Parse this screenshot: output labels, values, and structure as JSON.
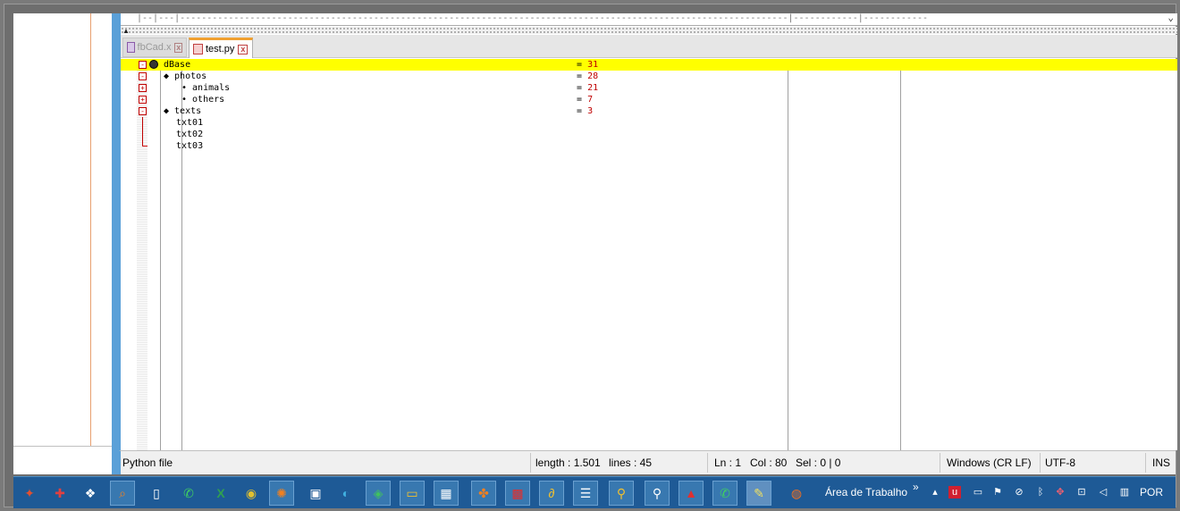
{
  "editor": {
    "ruler_text": "|--|---|-----------------------------------------------------------------------------------------------------------------|------------|------------",
    "tabs": [
      {
        "label": "fbCad.x",
        "close": "x"
      },
      {
        "label": "test.py",
        "close": "x"
      }
    ],
    "lines": [
      {
        "fold": "-",
        "text": "dBase",
        "value": "31",
        "indent": 0
      },
      {
        "fold": "-",
        "text": "◆ photos",
        "value": "28",
        "indent": 1
      },
      {
        "fold": "+",
        "text": "• animals",
        "value": "21",
        "indent": 2
      },
      {
        "fold": "+",
        "text": "• others",
        "value": "7",
        "indent": 2
      },
      {
        "fold": "-",
        "text": "◆ texts",
        "value": "3",
        "indent": 1
      },
      {
        "fold": "",
        "text": "txt01",
        "value": "",
        "indent": 1
      },
      {
        "fold": "",
        "text": "txt02",
        "value": "",
        "indent": 1
      },
      {
        "fold": "",
        "text": "txt03",
        "value": "",
        "indent": 1
      }
    ],
    "eq": "="
  },
  "statusbar": {
    "file_type": "Python file",
    "length": "length : 1.501",
    "lines": "lines : 45",
    "ln": "Ln : 1",
    "col": "Col : 80",
    "sel": "Sel : 0 | 0",
    "eol": "Windows (CR LF)",
    "encoding": "UTF-8",
    "mode": "INS"
  },
  "taskbar": {
    "desktop_label": "Área de Trabalho",
    "chevron": "»",
    "language": "POR"
  }
}
